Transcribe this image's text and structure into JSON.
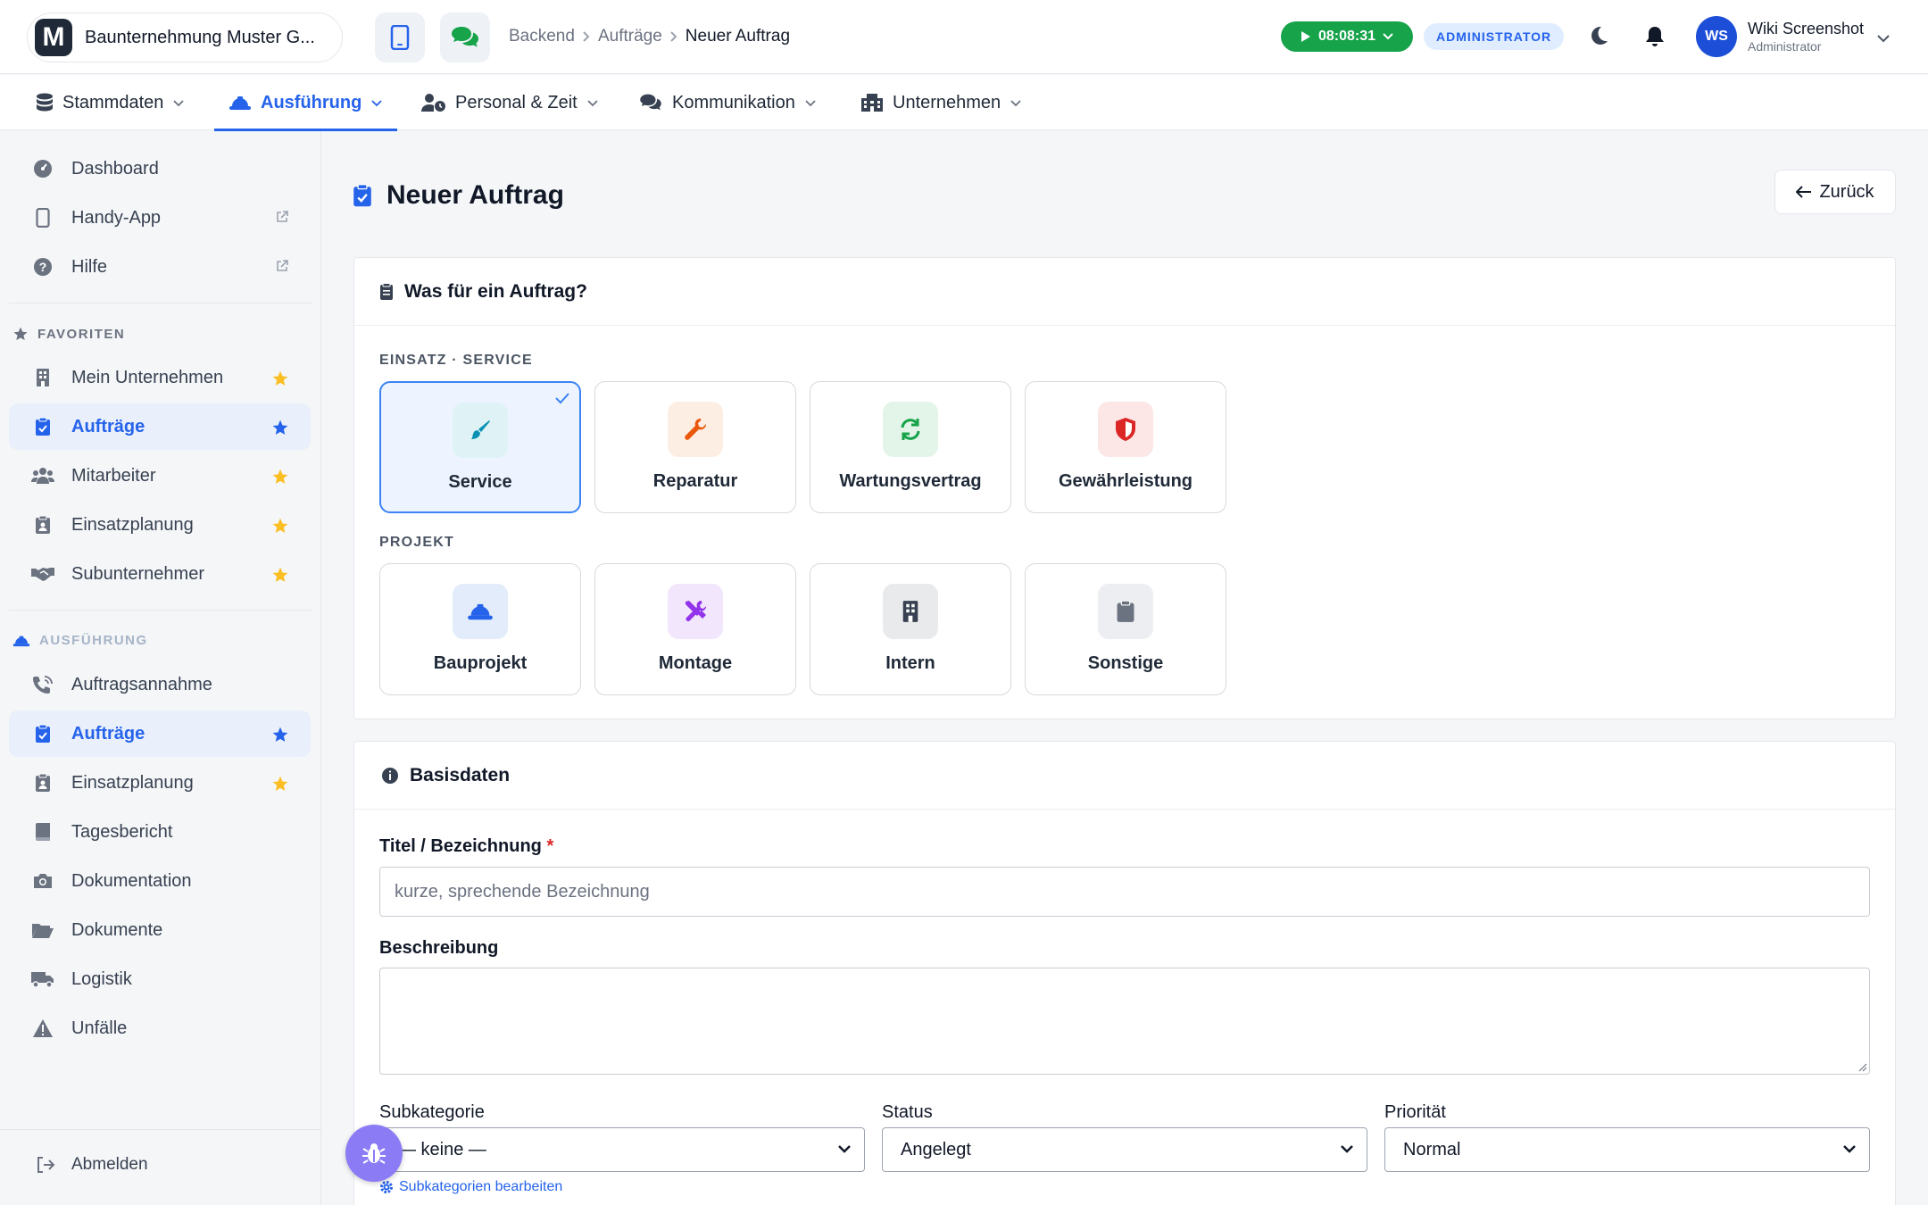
{
  "header": {
    "company_name": "Baunternehmung Muster G...",
    "logo_letter": "M",
    "breadcrumb": [
      "Backend",
      "Aufträge",
      "Neuer Auftrag"
    ],
    "timer": "08:08:31",
    "role_badge": "ADMINISTRATOR",
    "user": {
      "initials": "WS",
      "name": "Wiki Screenshot",
      "role": "Administrator"
    }
  },
  "nav": {
    "items": [
      {
        "label": "Stammdaten",
        "icon": "database-icon"
      },
      {
        "label": "Ausführung",
        "icon": "hardhat-icon",
        "active": true
      },
      {
        "label": "Personal & Zeit",
        "icon": "user-clock-icon"
      },
      {
        "label": "Kommunikation",
        "icon": "chat-icon"
      },
      {
        "label": "Unternehmen",
        "icon": "building-icon"
      }
    ]
  },
  "sidebar": {
    "top": [
      {
        "label": "Dashboard",
        "icon": "gauge-icon"
      },
      {
        "label": "Handy-App",
        "icon": "phone-icon",
        "external": true
      },
      {
        "label": "Hilfe",
        "icon": "help-icon",
        "external": true
      }
    ],
    "favorites_heading": "FAVORITEN",
    "favorites": [
      {
        "label": "Mein Unternehmen",
        "icon": "building-icon"
      },
      {
        "label": "Aufträge",
        "icon": "clipboard-check-icon",
        "active": true
      },
      {
        "label": "Mitarbeiter",
        "icon": "users-icon"
      },
      {
        "label": "Einsatzplanung",
        "icon": "clipboard-user-icon"
      },
      {
        "label": "Subunternehmer",
        "icon": "handshake-icon"
      }
    ],
    "section_heading": "AUSFÜHRUNG",
    "section": [
      {
        "label": "Auftragsannahme",
        "icon": "phone-volume-icon"
      },
      {
        "label": "Aufträge",
        "icon": "clipboard-check-icon",
        "active": true,
        "star": true
      },
      {
        "label": "Einsatzplanung",
        "icon": "clipboard-user-icon",
        "star": true
      },
      {
        "label": "Tagesbericht",
        "icon": "book-icon"
      },
      {
        "label": "Dokumentation",
        "icon": "camera-icon"
      },
      {
        "label": "Dokumente",
        "icon": "folder-icon"
      },
      {
        "label": "Logistik",
        "icon": "truck-icon"
      },
      {
        "label": "Unfälle",
        "icon": "warning-icon"
      }
    ],
    "logout": "Abmelden"
  },
  "main": {
    "title": "Neuer Auftrag",
    "back": "Zurück",
    "type_card": {
      "heading": "Was für ein Auftrag?",
      "group1_label": "EINSATZ · SERVICE",
      "group1": [
        {
          "label": "Service",
          "icon": "brush-icon",
          "color": "#0891b2",
          "bg": "#dff3f6",
          "selected": true
        },
        {
          "label": "Reparatur",
          "icon": "wrench-icon",
          "color": "#ea580c",
          "bg": "#fdeee3"
        },
        {
          "label": "Wartungsvertrag",
          "icon": "refresh-icon",
          "color": "#16a34a",
          "bg": "#e2f5e8"
        },
        {
          "label": "Gewährleistung",
          "icon": "shield-icon",
          "color": "#dc2626",
          "bg": "#fce6e6"
        }
      ],
      "group2_label": "PROJEKT",
      "group2": [
        {
          "label": "Bauprojekt",
          "icon": "hardhat-icon",
          "color": "#2563eb",
          "bg": "#e3ecfb"
        },
        {
          "label": "Montage",
          "icon": "tools-icon",
          "color": "#9333ea",
          "bg": "#f1e6fb"
        },
        {
          "label": "Intern",
          "icon": "building-icon",
          "color": "#374151",
          "bg": "#e9eaec"
        },
        {
          "label": "Sonstige",
          "icon": "clipboard-icon",
          "color": "#6b7280",
          "bg": "#eceef1"
        }
      ]
    },
    "basis_card": {
      "heading": "Basisdaten",
      "title_label": "Titel / Bezeichnung",
      "required_mark": "*",
      "title_placeholder": "kurze, sprechende Bezeichnung",
      "description_label": "Beschreibung",
      "subkategorie_label": "Subkategorie",
      "subkategorie_value": "— keine —",
      "subkategorie_link": "Subkategorien bearbeiten",
      "status_label": "Status",
      "status_value": "Angelegt",
      "prio_label": "Priorität",
      "prio_value": "Normal"
    }
  }
}
